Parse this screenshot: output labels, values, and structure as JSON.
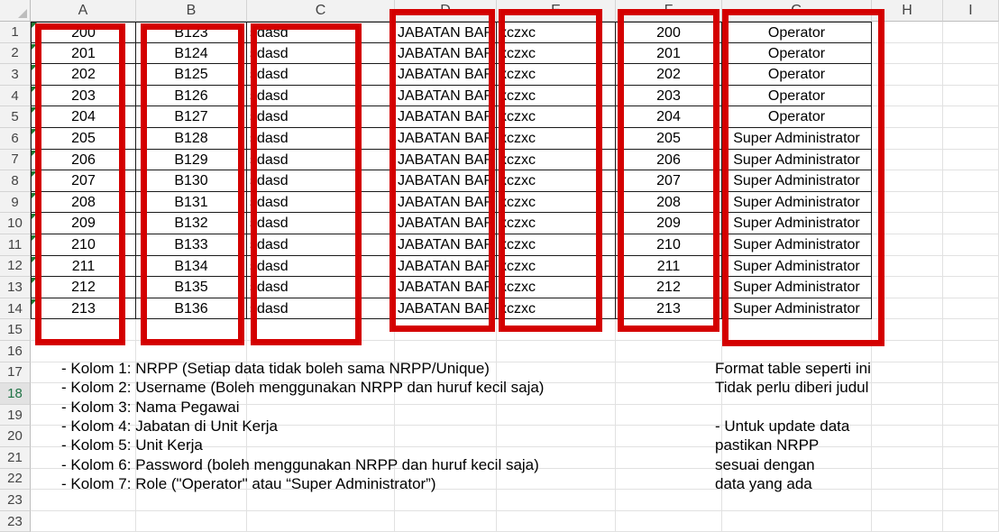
{
  "columns": [
    "A",
    "B",
    "C",
    "D",
    "E",
    "F",
    "G",
    "H",
    "I"
  ],
  "rows": [
    "1",
    "2",
    "3",
    "4",
    "5",
    "6",
    "7",
    "8",
    "9",
    "10",
    "11",
    "12",
    "13",
    "14",
    "15",
    "16",
    "17",
    "18",
    "19",
    "20",
    "21",
    "22",
    "23",
    "23"
  ],
  "selected_row": "18",
  "table": [
    [
      "200",
      "B123",
      "sdasd",
      "JABATAN BAR",
      "xczxc",
      "200",
      "Operator"
    ],
    [
      "201",
      "B124",
      "sdasd",
      "JABATAN BAR",
      "xczxc",
      "201",
      "Operator"
    ],
    [
      "202",
      "B125",
      "sdasd",
      "JABATAN BAR",
      "xczxc",
      "202",
      "Operator"
    ],
    [
      "203",
      "B126",
      "sdasd",
      "JABATAN BAR",
      "xczxc",
      "203",
      "Operator"
    ],
    [
      "204",
      "B127",
      "sdasd",
      "JABATAN BAR",
      "xczxc",
      "204",
      "Operator"
    ],
    [
      "205",
      "B128",
      "sdasd",
      "JABATAN BAR",
      "xczxc",
      "205",
      "Super Administrator"
    ],
    [
      "206",
      "B129",
      "sdasd",
      "JABATAN BAR",
      "xczxc",
      "206",
      "Super Administrator"
    ],
    [
      "207",
      "B130",
      "sdasd",
      "JABATAN BAR",
      "xczxc",
      "207",
      "Super Administrator"
    ],
    [
      "208",
      "B131",
      "sdasd",
      "JABATAN BAR",
      "xczxc",
      "208",
      "Super Administrator"
    ],
    [
      "209",
      "B132",
      "sdasd",
      "JABATAN BAR",
      "xczxc",
      "209",
      "Super Administrator"
    ],
    [
      "210",
      "B133",
      "sdasd",
      "JABATAN BAR",
      "xczxc",
      "210",
      "Super Administrator"
    ],
    [
      "211",
      "B134",
      "sdasd",
      "JABATAN BAR",
      "xczxc",
      "211",
      "Super Administrator"
    ],
    [
      "212",
      "B135",
      "sdasd",
      "JABATAN BAR",
      "xczxc",
      "212",
      "Super Administrator"
    ],
    [
      "213",
      "B136",
      "sdasd",
      "JABATAN BAR",
      "xczxc",
      "213",
      "Super Administrator"
    ]
  ],
  "notes_left": [
    "- Kolom 1: NRPP (Setiap data tidak boleh sama NRPP/Unique)",
    "- Kolom 2: Username (Boleh menggunakan NRPP dan huruf kecil saja)",
    "- Kolom 3: Nama Pegawai",
    "- Kolom 4: Jabatan di Unit Kerja",
    "- Kolom 5: Unit Kerja",
    "- Kolom 6: Password (boleh menggunakan NRPP dan huruf kecil saja)",
    "- Kolom 7: Role (\"Operator\" atau “Super Administrator”)"
  ],
  "notes_right": [
    "Format table seperti ini",
    "Tidak perlu diberi judul",
    "",
    "- Untuk update data",
    "pastikan NRPP",
    "sesuai dengan",
    "data yang ada"
  ],
  "colors": {
    "highlight_border": "#d40000",
    "header_bg": "#f2f2f2",
    "comment_marker": "#1e7b34"
  }
}
